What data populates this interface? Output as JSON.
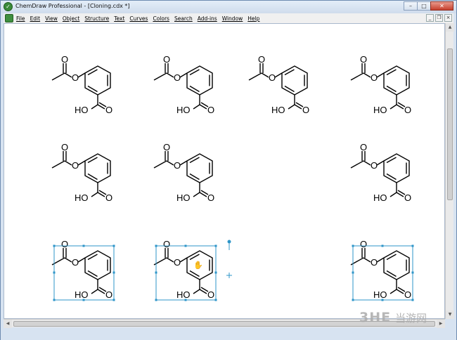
{
  "window": {
    "title": "ChemDraw Professional - [Cloning.cdx *]"
  },
  "caption_buttons": {
    "minimize": "–",
    "maximize": "□",
    "close": "✕"
  },
  "mdi_buttons": {
    "minimize": "_",
    "restore": "❐",
    "close": "×"
  },
  "menu": [
    {
      "label": "File"
    },
    {
      "label": "Edit"
    },
    {
      "label": "View"
    },
    {
      "label": "Object"
    },
    {
      "label": "Structure"
    },
    {
      "label": "Text"
    },
    {
      "label": "Curves"
    },
    {
      "label": "Colors"
    },
    {
      "label": "Search"
    },
    {
      "label": "Add-ins"
    },
    {
      "label": "Window"
    },
    {
      "label": "Help"
    }
  ],
  "molecule_labels": {
    "hydroxyl": "HO",
    "carbonyl_o": "O",
    "ester_o": "O",
    "acetyl_o": "O"
  },
  "molecules": [
    {
      "id": "r1c1",
      "selected": false,
      "cursor": false
    },
    {
      "id": "r1c2",
      "selected": false,
      "cursor": false
    },
    {
      "id": "r1c3",
      "selected": false,
      "cursor": false
    },
    {
      "id": "r1c4",
      "selected": false,
      "cursor": false
    },
    {
      "id": "r2c1",
      "selected": false,
      "cursor": false
    },
    {
      "id": "r2c2",
      "selected": false,
      "cursor": false
    },
    {
      "id": "r2c4",
      "selected": false,
      "cursor": false
    },
    {
      "id": "r3c1",
      "selected": true,
      "cursor": false
    },
    {
      "id": "r3c2",
      "selected": true,
      "cursor": true
    },
    {
      "id": "r3c4",
      "selected": true,
      "cursor": false
    }
  ],
  "selection_color": "#2e95c8",
  "watermark": {
    "logo": "3HE",
    "text": "当游网"
  }
}
